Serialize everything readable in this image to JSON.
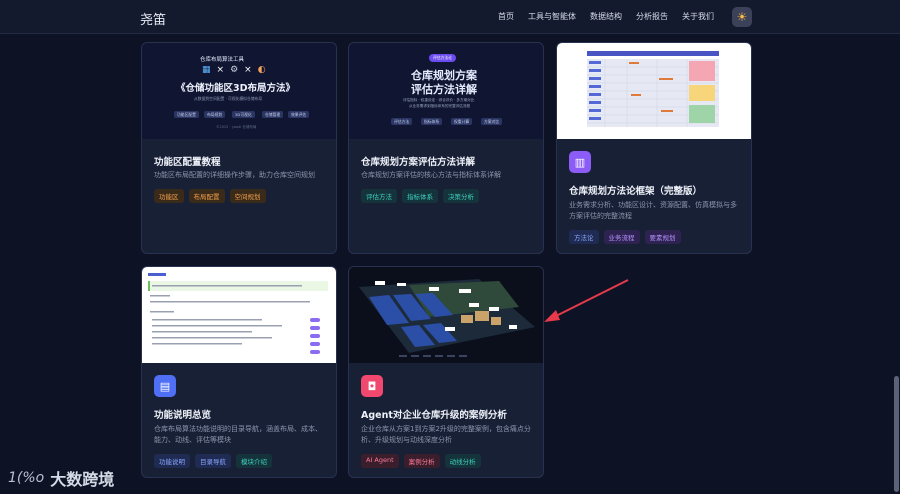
{
  "header": {
    "brand": "尧笛",
    "nav": [
      "首页",
      "工具与智能体",
      "数据结构",
      "分析报告",
      "关于我们"
    ],
    "theme_icon": "sun-icon"
  },
  "cards": [
    {
      "thumb": {
        "line1": "仓库布局算法工具",
        "line2": "《仓储功能区3D布局方法》",
        "line3": "从数据到空间配置 · 可视化模拟仓储布局",
        "buttons": [
          "功能区配置",
          "布局规划",
          "3D可视化",
          "仓储管理",
          "效果评估"
        ],
        "foot": "©2025 · yaodi 仓储布局"
      },
      "title": "功能区配置教程",
      "desc": "功能区布局配置的详细操作步骤，助力仓库空间规划",
      "tags": [
        "功能区",
        "布局配置",
        "空间规划"
      ]
    },
    {
      "thumb": {
        "badge": "评估方法论",
        "line1": "仓库规划方案",
        "line2": "评估方法详解",
        "line3": "评估指标 · 权重设定 · 综合评价 · 多方案对比",
        "line4": "从业务需求到指标体系的完整评估流程",
        "buttons": [
          "评估方法",
          "指标体系",
          "权重计算",
          "方案对比"
        ]
      },
      "title": "仓库规划方案评估方法详解",
      "desc": "仓库规划方案评估的核心方法与指标体系详解",
      "tags": [
        "评估方法",
        "指标体系",
        "决策分析"
      ]
    },
    {
      "title": "仓库规划方法论框架（完整版）",
      "desc": "业务需求分析、功能区设计、资源配置、仿真模拟与多方案评估的完整流程",
      "tags": [
        "方法论",
        "业务流程",
        "要素规划"
      ],
      "icon": "book-icon"
    },
    {
      "title": "功能说明总览",
      "desc": "仓库布局算法功能说明的目录导航，涵盖布局、成本、能力、动线、评估等模块",
      "tags": [
        "功能说明",
        "目录导航",
        "模块介绍"
      ],
      "icon": "document-icon"
    },
    {
      "title": "Agent对企业仓库升级的案例分析",
      "desc": "企业仓库从方案1到方案2升级的完整案例，包含痛点分析、升级规划与动线深度分析",
      "tags": [
        "AI Agent",
        "案例分析",
        "动线分析"
      ],
      "icon": "robot-icon"
    }
  ],
  "watermark": {
    "logo": "1(%o",
    "text": "大数跨境"
  },
  "colors": {
    "background": "#0d1224",
    "card": "#182036",
    "arrow": "#e8394a"
  }
}
